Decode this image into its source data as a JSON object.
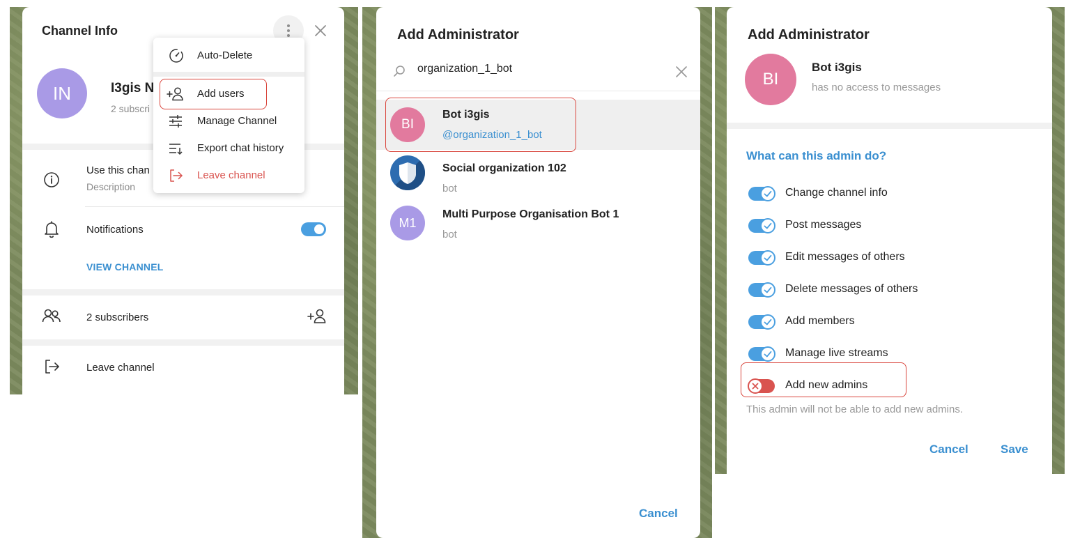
{
  "colors": {
    "accent": "#3a8fd0",
    "toggle_on": "#4a9fe0",
    "toggle_off": "#d9534f",
    "highlight_border": "#d9453c",
    "danger": "#d9534f",
    "avatar_in": "#a99ae6",
    "avatar_bi": "#e27a9e",
    "avatar_m1": "#a99ae6"
  },
  "channel_info": {
    "title": "Channel Info",
    "avatar_initials": "IN",
    "channel_name": "I3gis N",
    "subscribers_short": "2 subscri",
    "description_text": "Use this chan",
    "description_label": "Description",
    "notifications_label": "Notifications",
    "notifications_on": true,
    "view_channel": "VIEW CHANNEL",
    "subscribers_label": "2 subscribers",
    "leave_label": "Leave channel",
    "icons": {
      "more": "vertical-dots-icon",
      "close": "close-icon",
      "info": "info-icon",
      "bell": "bell-icon",
      "users": "users-icon",
      "add_user": "add-user-icon",
      "leave": "leave-icon"
    }
  },
  "context_menu": {
    "items": [
      {
        "label": "Auto-Delete",
        "icon": "timer-icon"
      },
      {
        "label": "Add users",
        "icon": "add-user-icon"
      },
      {
        "label": "Manage Channel",
        "icon": "sliders-icon"
      },
      {
        "label": "Export chat history",
        "icon": "export-icon"
      },
      {
        "label": "Leave channel",
        "icon": "leave-icon",
        "danger": true
      }
    ]
  },
  "add_admin_search": {
    "title": "Add Administrator",
    "search_value": "organization_1_bot",
    "results": [
      {
        "initials": "BI",
        "name": "Bot i3gis",
        "sub": "@organization_1_bot"
      },
      {
        "initials": "",
        "name": "Social organization 102",
        "sub": "bot"
      },
      {
        "initials": "M1",
        "name": "Multi Purpose Organisation Bot 1",
        "sub": "bot"
      }
    ],
    "cancel": "Cancel"
  },
  "add_admin_rights": {
    "title": "Add Administrator",
    "avatar_initials": "BI",
    "bot_name": "Bot i3gis",
    "bot_status": "has no access to messages",
    "section_title": "What can this admin do?",
    "permissions": [
      {
        "label": "Change channel info",
        "enabled": true
      },
      {
        "label": "Post messages",
        "enabled": true
      },
      {
        "label": "Edit messages of others",
        "enabled": true
      },
      {
        "label": "Delete messages of others",
        "enabled": true
      },
      {
        "label": "Add members",
        "enabled": true
      },
      {
        "label": "Manage live streams",
        "enabled": true
      },
      {
        "label": "Add new admins",
        "enabled": false
      }
    ],
    "note": "This admin will not be able to add new admins.",
    "cancel": "Cancel",
    "save": "Save"
  }
}
